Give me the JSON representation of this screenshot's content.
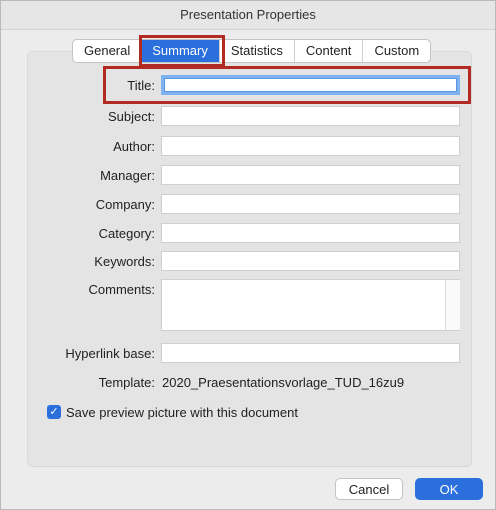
{
  "window": {
    "title": "Presentation Properties"
  },
  "tabs": [
    {
      "label": "General"
    },
    {
      "label": "Summary",
      "active": true
    },
    {
      "label": "Statistics"
    },
    {
      "label": "Content"
    },
    {
      "label": "Custom"
    }
  ],
  "fields": {
    "title": {
      "label": "Title:",
      "value": ""
    },
    "subject": {
      "label": "Subject:",
      "value": ""
    },
    "author": {
      "label": "Author:",
      "value": ""
    },
    "manager": {
      "label": "Manager:",
      "value": ""
    },
    "company": {
      "label": "Company:",
      "value": ""
    },
    "category": {
      "label": "Category:",
      "value": ""
    },
    "keywords": {
      "label": "Keywords:",
      "value": ""
    },
    "comments": {
      "label": "Comments:",
      "value": ""
    },
    "hyperlink_base": {
      "label": "Hyperlink base:",
      "value": ""
    }
  },
  "template": {
    "label": "Template:",
    "value": "2020_Praesentationsvorlage_TUD_16zu9"
  },
  "save_preview": {
    "label": "Save preview picture with this document",
    "checked": true
  },
  "buttons": {
    "cancel": "Cancel",
    "ok": "OK"
  },
  "colors": {
    "accent": "#2a6fdb",
    "highlight": "#b22b22"
  }
}
